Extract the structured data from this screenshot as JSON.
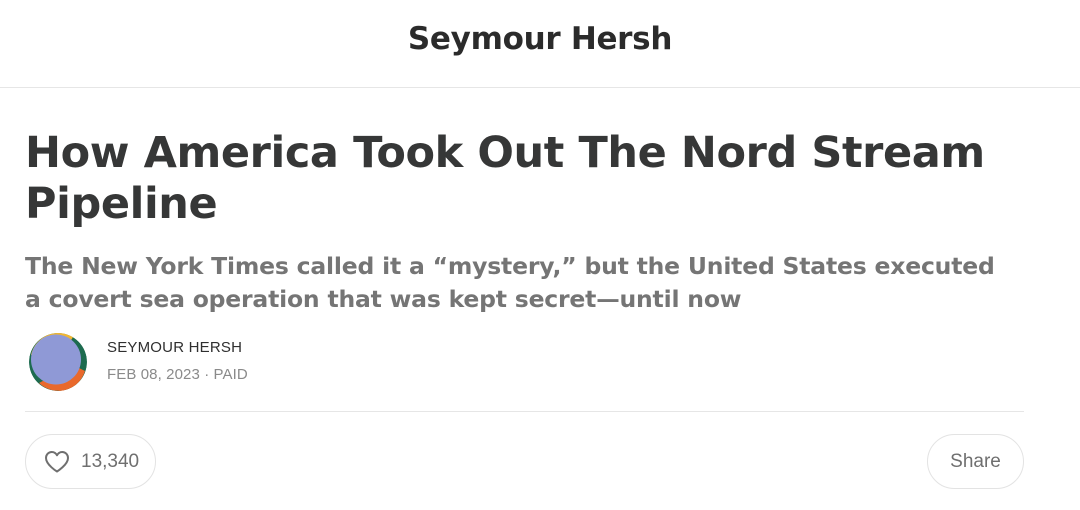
{
  "header": {
    "publication_name": "Seymour Hersh"
  },
  "post": {
    "title": "How America Took Out The Nord Stream Pipeline",
    "subtitle": "The New York Times called it a “mystery,” but the United States executed a covert sea operation that was kept secret—until now"
  },
  "byline": {
    "author": "SEYMOUR HERSH",
    "meta": "FEB 08, 2023 · PAID",
    "avatar_icon": "author-avatar"
  },
  "actions": {
    "like_icon": "heart-icon",
    "like_count": "13,340",
    "share_label": "Share"
  },
  "colors": {
    "title": "#363737",
    "subtitle": "#757575",
    "divider": "#e6e6e6",
    "avatar_main": "#8f99d6",
    "avatar_ring_orange": "#e9692c",
    "avatar_ring_yellow": "#f2b632",
    "avatar_ring_green": "#1d6b4f"
  }
}
